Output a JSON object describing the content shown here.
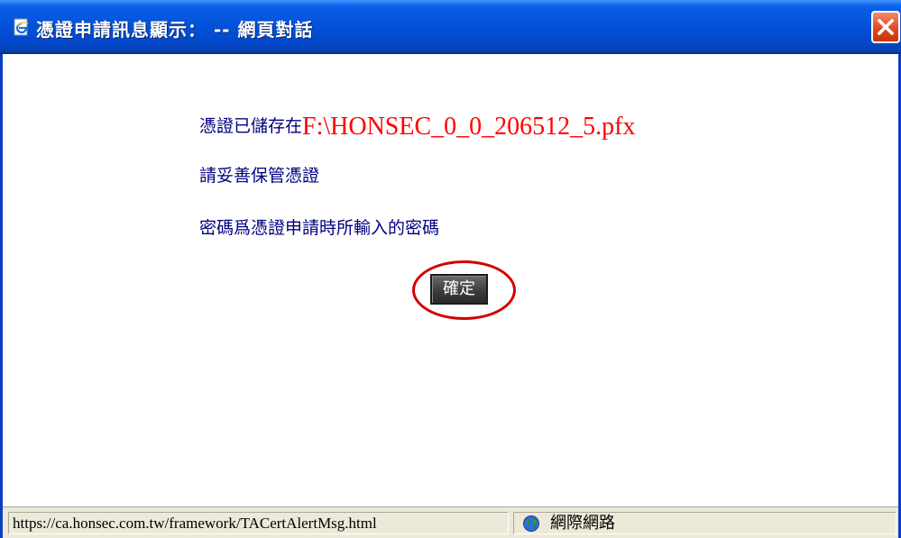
{
  "window": {
    "title": "憑證申請訊息顯示： -- 網頁對話",
    "icon": "ie-page-icon",
    "close_icon": "close-icon"
  },
  "message": {
    "saved_prefix": "憑證已儲存在",
    "file_path": "F:\\HONSEC_0_0_206512_5.pfx",
    "keep_safe": "請妥善保管憑證",
    "password_note": "密碼爲憑證申請時所輸入的密碼"
  },
  "buttons": {
    "ok_label": "確定"
  },
  "statusbar": {
    "url": "https://ca.honsec.com.tw/framework/TACertAlertMsg.html",
    "zone_icon": "globe-icon",
    "zone_label": "網際網路"
  },
  "colors": {
    "titlebar": "#0352d9",
    "message_text": "#000080",
    "path_text": "#ff0000",
    "highlight_circle": "#d40000"
  }
}
